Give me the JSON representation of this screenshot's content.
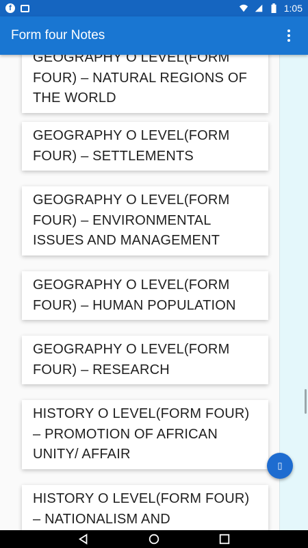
{
  "status_bar": {
    "time": "1:05",
    "icons": [
      "facebook-icon",
      "image-icon",
      "wifi-icon",
      "signal-icon",
      "battery-icon"
    ]
  },
  "app_bar": {
    "title": "Form four Notes",
    "menu_icon": "more-vert-icon"
  },
  "notes": [
    "GEOGRAPHY O LEVEL(FORM FOUR) – NATURAL REGIONS OF THE WORLD",
    "GEOGRAPHY O LEVEL(FORM FOUR) – SETTLEMENTS",
    "GEOGRAPHY O LEVEL(FORM FOUR) – ENVIRONMENTAL ISSUES AND MANAGEMENT",
    "GEOGRAPHY O LEVEL(FORM FOUR) – HUMAN POPULATION",
    "GEOGRAPHY O LEVEL(FORM FOUR) – RESEARCH",
    "HISTORY O LEVEL(FORM FOUR) – PROMOTION OF AFRICAN UNITY/ AFFAIR",
    "HISTORY O LEVEL(FORM FOUR) – NATIONALISM AND"
  ],
  "fab": {
    "icon": "action-icon"
  },
  "nav_bar": {
    "icons": [
      "back-icon",
      "home-icon",
      "recents-icon"
    ]
  },
  "colors": {
    "status_bar": "#1565c0",
    "app_bar": "#1976d2",
    "fab": "#1e6cd0",
    "right_panel": "#e4f7fb"
  }
}
